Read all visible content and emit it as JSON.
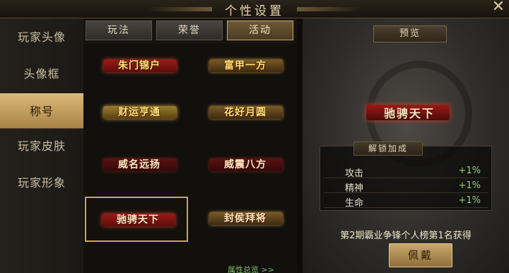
{
  "header": {
    "title": "个性设置"
  },
  "sidebar": {
    "items": [
      {
        "label": "玩家头像"
      },
      {
        "label": "头像框"
      },
      {
        "label": "称号"
      },
      {
        "label": "玩家皮肤"
      },
      {
        "label": "玩家形象"
      }
    ],
    "active_index": 2
  },
  "tabs": {
    "items": [
      {
        "label": "玩法"
      },
      {
        "label": "荣誉"
      },
      {
        "label": "活动"
      }
    ],
    "active_index": 2
  },
  "titles": [
    {
      "label": "朱门锦户",
      "style": "red"
    },
    {
      "label": "富甲一方",
      "style": "brown"
    },
    {
      "label": "财运亨通",
      "style": "gold"
    },
    {
      "label": "花好月圆",
      "style": "brown"
    },
    {
      "label": "威名远扬",
      "style": "dark"
    },
    {
      "label": "威震八方",
      "style": "dark"
    },
    {
      "label": "驰骋天下",
      "style": "red"
    },
    {
      "label": "封侯拜将",
      "style": "brown"
    }
  ],
  "selected_title_index": 6,
  "attr_overview_link": "属性总览 >>",
  "preview": {
    "tag": "预览",
    "title": "驰骋天下",
    "unlock_header": "解锁加成",
    "stats": [
      {
        "name": "攻击",
        "value": "+1%"
      },
      {
        "name": "精神",
        "value": "+1%"
      },
      {
        "name": "生命",
        "value": "+1%"
      }
    ],
    "description": "第2期霸业争锋个人榜第1名获得",
    "wear_button": "佩戴"
  },
  "colors": {
    "accent_gold": "#c8a55a",
    "stat_green": "#8fd36d",
    "banner_red": "#9a1b18"
  }
}
